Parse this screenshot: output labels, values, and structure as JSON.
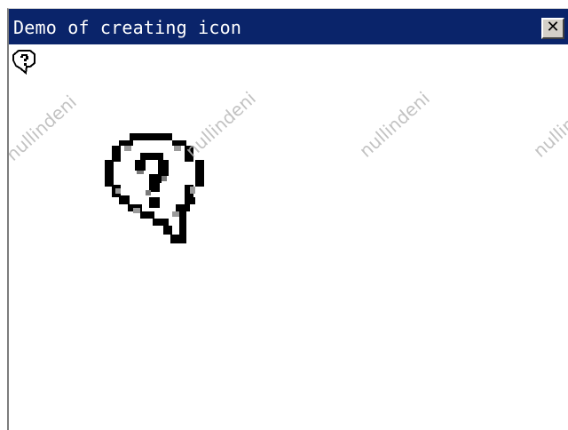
{
  "window": {
    "title": "Demo of creating icon",
    "close_glyph": "✕",
    "titlebar_color": "#0a246a"
  },
  "icons": {
    "small": "help-bubble-icon",
    "large": "help-bubble-icon"
  },
  "watermark": {
    "text": "nullindeni",
    "color": "#b8b8b8"
  }
}
